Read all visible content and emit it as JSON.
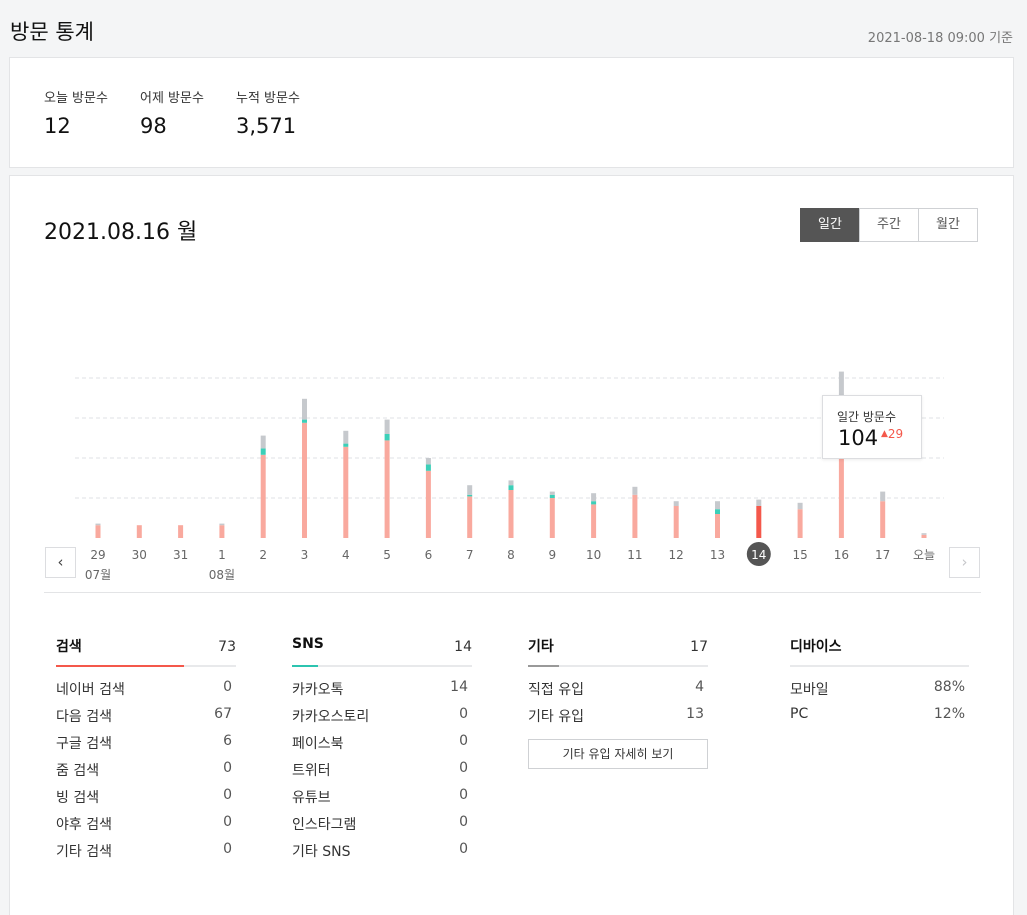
{
  "page": {
    "title": "방문 통계",
    "timestamp": "2021-08-18 09:00 기준"
  },
  "summary": [
    {
      "label": "오늘 방문수",
      "value": "12"
    },
    {
      "label": "어제 방문수",
      "value": "98"
    },
    {
      "label": "누적 방문수",
      "value": "3,571"
    }
  ],
  "chart_header": {
    "date": "2021.08.16 월"
  },
  "period_tabs": [
    {
      "label": "일간",
      "active": true
    },
    {
      "label": "주간",
      "active": false
    },
    {
      "label": "월간",
      "active": false
    }
  ],
  "tooltip": {
    "label": "일간 방문수",
    "value": "104",
    "change": "29"
  },
  "colors": {
    "search": "#f9a99e",
    "search_selected": "#f4584b",
    "sns": "#3ccfb8",
    "other": "#c6c9cd",
    "accent": "#f4584b"
  },
  "icons": {
    "prev": "chevron-left-icon",
    "next": "chevron-right-icon",
    "change": "caret-up-icon"
  },
  "chart_data": {
    "type": "bar",
    "stacked": true,
    "x": [
      "29",
      "30",
      "31",
      "1",
      "2",
      "3",
      "4",
      "5",
      "6",
      "7",
      "8",
      "9",
      "10",
      "11",
      "12",
      "13",
      "14",
      "15",
      "16",
      "17",
      "오늘"
    ],
    "month_labels": [
      {
        "index": 0,
        "label": "07월"
      },
      {
        "index": 3,
        "label": "08월"
      }
    ],
    "selected_index": 16,
    "series": [
      {
        "key": "search",
        "values": [
          8,
          8,
          8,
          8,
          52,
          72,
          57,
          61,
          42,
          26,
          30,
          25,
          21,
          27,
          20,
          15,
          20,
          18,
          73,
          23,
          2
        ]
      },
      {
        "key": "sns",
        "values": [
          0,
          0,
          0,
          0,
          4,
          2,
          2,
          4,
          4,
          1,
          3,
          2,
          2,
          0,
          0,
          3,
          0,
          0,
          14,
          0,
          0
        ]
      },
      {
        "key": "other",
        "values": [
          1,
          0,
          0,
          1,
          8,
          13,
          8,
          9,
          4,
          6,
          3,
          2,
          5,
          5,
          3,
          5,
          4,
          4,
          17,
          6,
          1
        ]
      }
    ],
    "ylim": [
      0,
      125
    ],
    "grid": true
  },
  "stats": [
    {
      "name": "검색",
      "total": "73",
      "color": "#f4584b",
      "rows": [
        {
          "label": "네이버 검색",
          "value": "0"
        },
        {
          "label": "다음 검색",
          "value": "67"
        },
        {
          "label": "구글 검색",
          "value": "6"
        },
        {
          "label": "줌 검색",
          "value": "0"
        },
        {
          "label": "빙 검색",
          "value": "0"
        },
        {
          "label": "야후 검색",
          "value": "0"
        },
        {
          "label": "기타 검색",
          "value": "0"
        }
      ]
    },
    {
      "name": "SNS",
      "total": "14",
      "color": "#2cc4b0",
      "rows": [
        {
          "label": "카카오톡",
          "value": "14"
        },
        {
          "label": "카카오스토리",
          "value": "0"
        },
        {
          "label": "페이스북",
          "value": "0"
        },
        {
          "label": "트위터",
          "value": "0"
        },
        {
          "label": "유튜브",
          "value": "0"
        },
        {
          "label": "인스타그램",
          "value": "0"
        },
        {
          "label": "기타 SNS",
          "value": "0"
        }
      ]
    },
    {
      "name": "기타",
      "total": "17",
      "color": "#999999",
      "rows": [
        {
          "label": "직접 유입",
          "value": "4"
        },
        {
          "label": "기타 유입",
          "value": "13"
        }
      ],
      "button": "기타 유입 자세히 보기"
    },
    {
      "name": "디바이스",
      "total": "",
      "color": "",
      "rows": [
        {
          "label": "모바일",
          "value": "88%"
        },
        {
          "label": "PC",
          "value": "12%"
        }
      ]
    }
  ]
}
